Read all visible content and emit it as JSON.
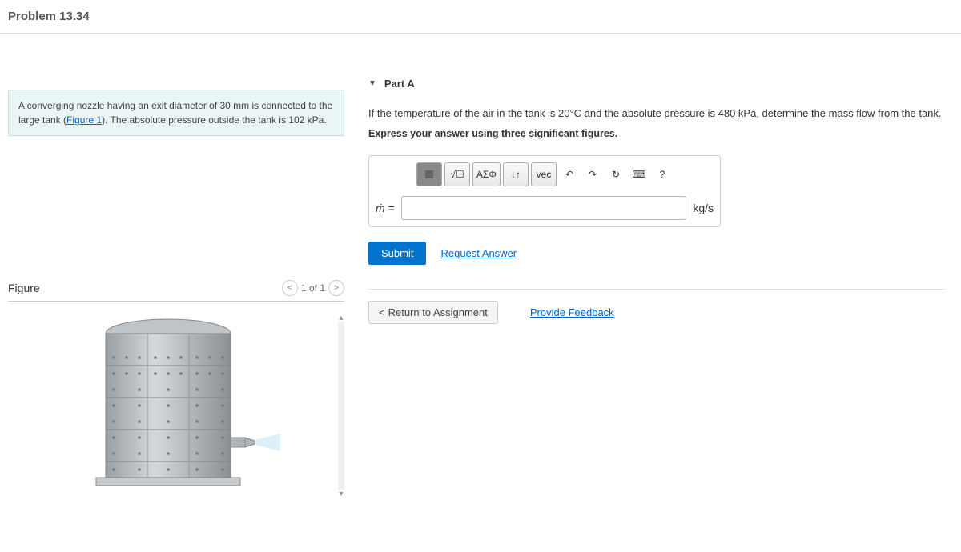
{
  "header": {
    "title": "Problem 13.34"
  },
  "problem": {
    "text_before_link": "A converging nozzle having an exit diameter of 30 mm is connected to the large tank (",
    "figure_link": "Figure 1",
    "text_after_link": "). The absolute pressure outside the tank is 102 kPa."
  },
  "figure": {
    "title": "Figure",
    "page": "1 of 1",
    "prev": "<",
    "next": ">",
    "scroll_up": "▲",
    "scroll_down": "▼"
  },
  "part": {
    "caret": "▼",
    "title": "Part A",
    "question": "If the temperature of the air in the tank is 20°C and the absolute pressure is 480 kPa, determine the mass flow from the tank.",
    "instruction": "Express your answer using three significant figures."
  },
  "toolbar": {
    "template": "▢",
    "fraction": "√☐",
    "greek": "ΑΣΦ",
    "subscript": "↓↑",
    "vec": "vec",
    "undo": "↶",
    "redo": "↷",
    "reset": "↻",
    "keyboard": "⌨",
    "help": "?"
  },
  "answer": {
    "var": "ṁ =",
    "value": "",
    "unit": "kg/s"
  },
  "actions": {
    "submit": "Submit",
    "request": "Request Answer",
    "return": "Return to Assignment",
    "feedback": "Provide Feedback"
  }
}
